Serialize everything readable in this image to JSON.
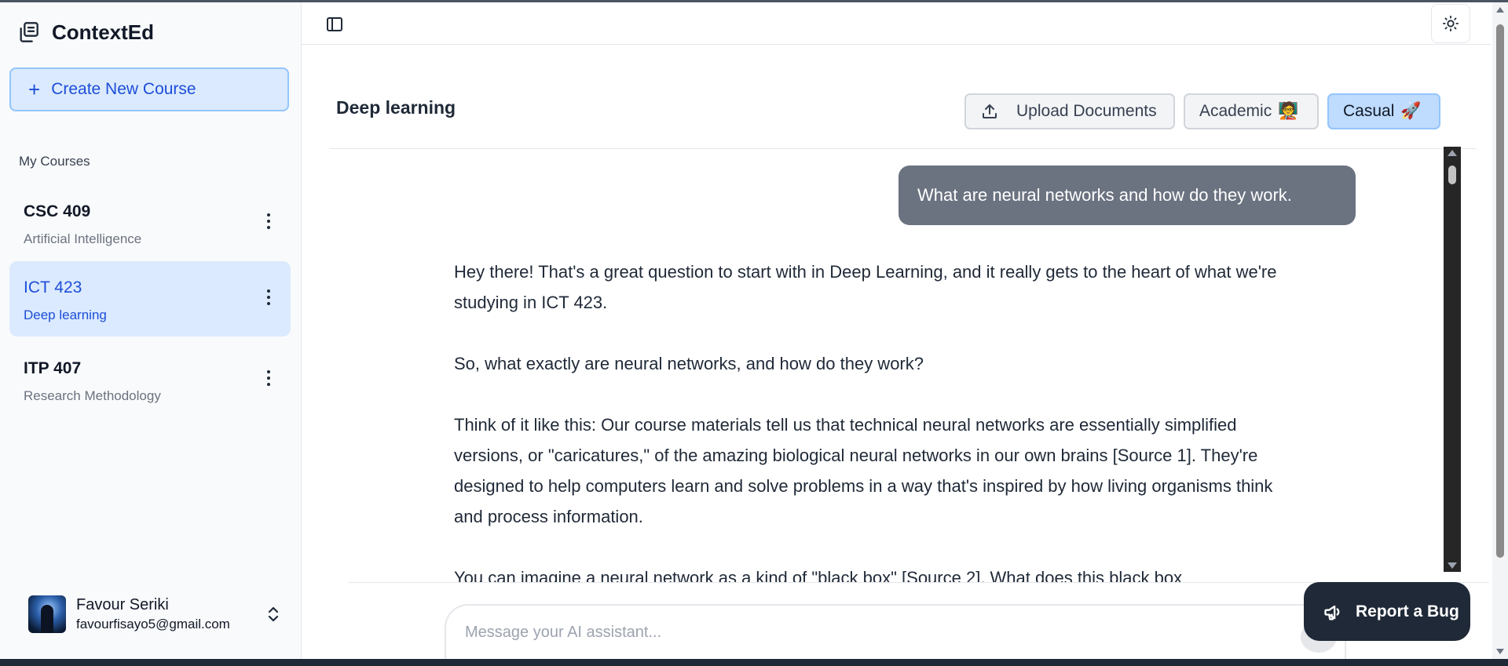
{
  "app": {
    "brand": "ContextEd"
  },
  "sidebar": {
    "create_button": "Create New Course",
    "section_label": "My Courses",
    "courses": [
      {
        "code": "CSC 409",
        "name": "Artificial Intelligence",
        "active": false
      },
      {
        "code": "ICT 423",
        "name": "Deep learning",
        "active": true
      },
      {
        "code": "ITP 407",
        "name": "Research Methodology",
        "active": false
      }
    ],
    "user": {
      "name": "Favour Seriki",
      "email": "favourfisayo5@gmail.com"
    }
  },
  "header": {
    "course_title": "Deep learning",
    "upload_label": "Upload Documents",
    "academic_label": "Academic",
    "academic_emoji": "🧑‍🏫",
    "casual_label": "Casual",
    "casual_emoji": "🚀",
    "selected_mode": "Casual"
  },
  "chat": {
    "user_message": "What are neural networks and how do they work.",
    "ai_paragraphs": [
      "Hey there! That's a great question to start with in Deep Learning, and it really gets to the heart of what we're studying in ICT 423.",
      "So, what exactly are neural networks, and how do they work?",
      "Think of it like this: Our course materials tell us that technical neural networks are essentially simplified versions, or \"caricatures,\" of the amazing biological neural networks in our own brains [Source 1]. They're designed to help computers learn and solve problems in a way that's inspired by how living organisms think and process information.",
      "You can imagine a neural network as a kind of \"black box\" [Source 2]. What does this black box"
    ]
  },
  "composer": {
    "placeholder": "Message your AI assistant..."
  },
  "report": {
    "label": "Report a Bug"
  },
  "colors": {
    "accent": "#1d4ed8",
    "accent_light": "#dbeafe",
    "bubble": "#6b7280",
    "dark_button": "#1f2937"
  }
}
